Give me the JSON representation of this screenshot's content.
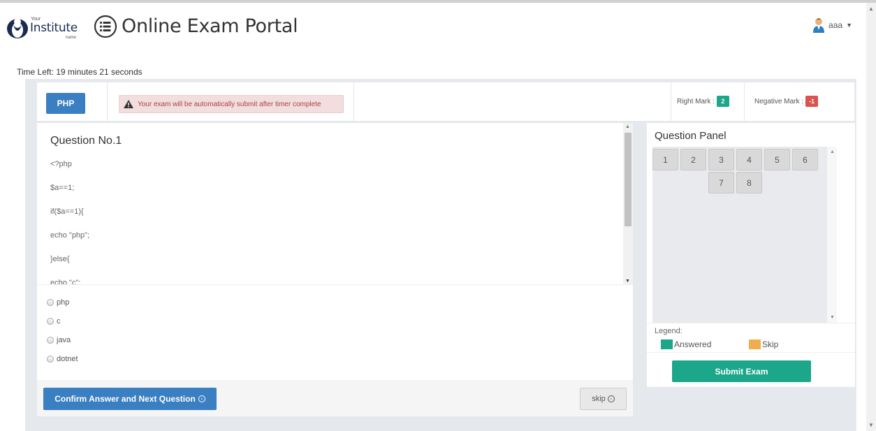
{
  "header": {
    "logo_your": "Your",
    "logo_institute": "Institute",
    "logo_name": "name",
    "title": "Online Exam Portal",
    "user_name": "aaa"
  },
  "timer": {
    "text": "Time Left: 19 minutes 21 seconds"
  },
  "topbar": {
    "subject": "PHP",
    "alert": "Your exam will be automatically submit after timer complete",
    "right_mark_label": "Right Mark :",
    "right_mark_value": "2",
    "negative_mark_label": "Negative Mark :",
    "negative_mark_value": "-1"
  },
  "question": {
    "title": "Question No.1",
    "code_lines": [
      "<?php",
      "$a==1;",
      "if($a==1){",
      "echo \"php\";",
      "}else{",
      "echo \"c\";"
    ],
    "options": [
      "php",
      "c",
      "java",
      "dotnet"
    ]
  },
  "footer": {
    "confirm_label": "Confirm Answer and Next Question",
    "skip_label": "skip"
  },
  "panel": {
    "title": "Question Panel",
    "numbers": [
      "1",
      "2",
      "3",
      "4",
      "5",
      "6",
      "7",
      "8"
    ],
    "legend_label": "Legend:",
    "legend_answered": "Answered",
    "legend_skip": "Skip",
    "submit_label": "Submit Exam"
  },
  "colors": {
    "primary": "#3a7fc1",
    "answered": "#1ca68a",
    "skip": "#f0ad4e",
    "right_badge": "#1ca68a",
    "negative_badge": "#d9534f"
  }
}
